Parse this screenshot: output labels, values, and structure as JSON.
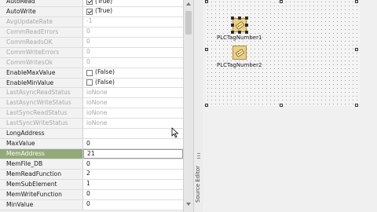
{
  "properties": [
    {
      "name": "AutoRead",
      "value": "(True)",
      "type": "check",
      "checked": true,
      "readonly": false
    },
    {
      "name": "AutoWrite",
      "value": "(True)",
      "type": "check",
      "checked": true,
      "readonly": false
    },
    {
      "name": "AvgUpdateRate",
      "value": "-1",
      "type": "text",
      "readonly": true
    },
    {
      "name": "CommReadErrors",
      "value": "0",
      "type": "text",
      "readonly": true
    },
    {
      "name": "CommReadsOK",
      "value": "0",
      "type": "text",
      "readonly": true
    },
    {
      "name": "CommWriteErrors",
      "value": "0",
      "type": "text",
      "readonly": true
    },
    {
      "name": "CommWritesOk",
      "value": "0",
      "type": "text",
      "readonly": true
    },
    {
      "name": "EnableMaxValue",
      "value": "(False)",
      "type": "check",
      "checked": false,
      "readonly": false
    },
    {
      "name": "EnableMinValue",
      "value": "(False)",
      "type": "check",
      "checked": false,
      "readonly": false
    },
    {
      "name": "LastAsyncReadStatus",
      "value": "ioNone",
      "type": "text",
      "readonly": true
    },
    {
      "name": "LastAsyncWriteStatus",
      "value": "ioNone",
      "type": "text",
      "readonly": true
    },
    {
      "name": "LastSyncReadStatus",
      "value": "ioNone",
      "type": "text",
      "readonly": true
    },
    {
      "name": "LastSyncWriteStatus",
      "value": "ioNone",
      "type": "text",
      "readonly": true
    },
    {
      "name": "LongAddress",
      "value": "",
      "type": "text",
      "readonly": false
    },
    {
      "name": "MaxValue",
      "value": "0",
      "type": "text",
      "readonly": false
    },
    {
      "name": "MemAddress",
      "value": "21",
      "type": "text",
      "readonly": false,
      "selected": true
    },
    {
      "name": "MemFile_DB",
      "value": "0",
      "type": "text",
      "readonly": false
    },
    {
      "name": "MemReadFunction",
      "value": "2",
      "type": "text",
      "readonly": false
    },
    {
      "name": "MemSubElement",
      "value": "1",
      "type": "text",
      "readonly": false
    },
    {
      "name": "MemWriteFunction",
      "value": "0",
      "type": "text",
      "readonly": false
    },
    {
      "name": "MinValue",
      "value": "0",
      "type": "text",
      "readonly": false
    }
  ],
  "side_tab": {
    "label": "Source Editor"
  },
  "designer": {
    "components": [
      {
        "label": "PLCTagNumber1",
        "icon": "plc-tag-icon",
        "selected": true
      },
      {
        "label": "PLCTagNumber2",
        "icon": "plc-tag-icon",
        "selected": false
      }
    ]
  },
  "colors": {
    "selected_row": "#93a97a",
    "component_tile": "#e9cf8a"
  }
}
